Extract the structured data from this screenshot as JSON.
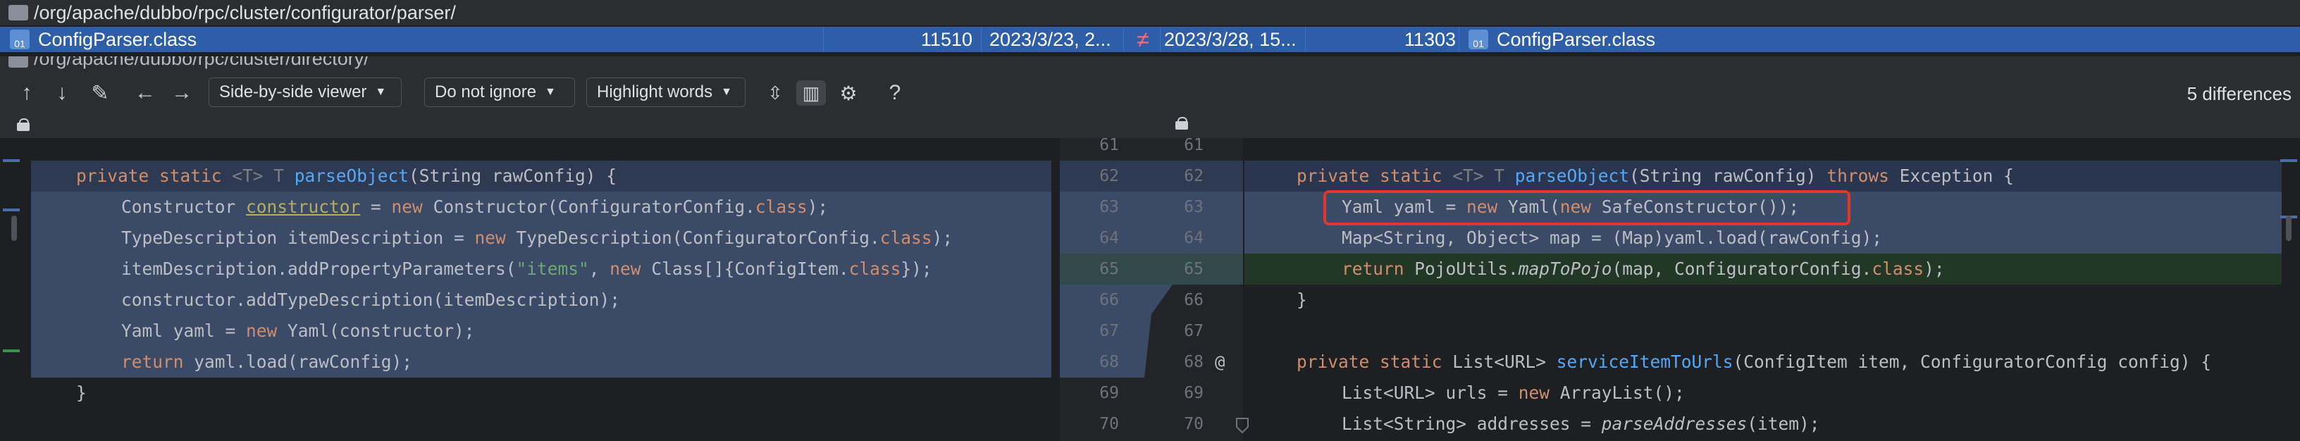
{
  "file_list": {
    "path_row": "/org/apache/dubbo/rpc/cluster/configurator/parser/",
    "selected": {
      "name_left": "ConfigParser.class",
      "size_left": "11510",
      "date_left": "2023/3/23, 2...",
      "diff_symbol": "≠",
      "date_right": "2023/3/28, 15...",
      "size_right": "11303",
      "name_right": "ConfigParser.class",
      "icon_text": "01"
    },
    "next_row": "/org/apache/dubbo/rpc/cluster/directory/"
  },
  "toolbar": {
    "viewer_label": "Side-by-side viewer",
    "ignore_label": "Do not ignore",
    "highlight_label": "Highlight words",
    "help_label": "?",
    "differences": "5 differences"
  },
  "left_code": {
    "line1_kw": "private static ",
    "line1_gen": "<T> T ",
    "line1_fn": "parseObject",
    "line1_rest": "(String rawConfig) {",
    "line2_a": "Constructor ",
    "line2_var": "constructor",
    "line2_b": " = ",
    "line2_kw": "new",
    "line2_c": " Constructor(ConfiguratorConfig.",
    "line2_kw2": "class",
    "line2_d": ");",
    "line3_a": "TypeDescription itemDescription = ",
    "line3_kw": "new",
    "line3_b": " TypeDescription(ConfiguratorConfig.",
    "line3_kw2": "class",
    "line3_c": ");",
    "line4_a": "itemDescription.addPropertyParameters(",
    "line4_str": "\"items\"",
    "line4_b": ", ",
    "line4_kw": "new",
    "line4_c": " Class[]{ConfigItem.",
    "line4_kw2": "class",
    "line4_d": "});",
    "line5": "constructor.addTypeDescription(itemDescription);",
    "line6_a": "Yaml yaml = ",
    "line6_kw": "new",
    "line6_b": " Yaml(constructor);",
    "line7_kw": "return",
    "line7_b": " yaml.load(rawConfig);",
    "line8": "}"
  },
  "gutter": {
    "left_nums": [
      "61",
      "62",
      "63",
      "64",
      "65",
      "66",
      "67",
      "68",
      "69",
      "70"
    ],
    "right_nums": [
      "61",
      "62",
      "63",
      "64",
      "65",
      "66",
      "67",
      "68",
      "69",
      "70"
    ],
    "at_symbol": "@"
  },
  "right_code": {
    "line1_kw": "private static ",
    "line1_gen": "<T> T ",
    "line1_fn": "parseObject",
    "line1_mid": "(String rawConfig) ",
    "line1_kw2": "throws",
    "line1_rest": " Exception {",
    "line2_a": "Yaml yaml = ",
    "line2_kw": "new",
    "line2_b": " Yaml(",
    "line2_kw2": "new",
    "line2_c": " SafeConstructor());",
    "line3_a": "Map<String, Object> map = (Map)yaml.load(rawConfig);",
    "line4_kw": "return",
    "line4_a": " PojoUtils.",
    "line4_it": "mapToPojo",
    "line4_b": "(map, ConfiguratorConfig.",
    "line4_kw2": "class",
    "line4_c": ");",
    "line5": "}",
    "line7_kw": "private static ",
    "line7_a": "List<URL> ",
    "line7_fn": "serviceItemToUrls",
    "line7_b": "(ConfigItem item, ConfiguratorConfig config) {",
    "line8_a": "List<URL> urls = ",
    "line8_kw": "new",
    "line8_b": " ArrayList();",
    "line9_a": "List<String> addresses = ",
    "line9_it": "parseAddresses",
    "line9_b": "(item);"
  },
  "colors": {
    "selection": "#2e5ea8",
    "changed_bg": "#3a4a67",
    "added_bg": "#233727",
    "highlight_box": "#e0362c"
  }
}
